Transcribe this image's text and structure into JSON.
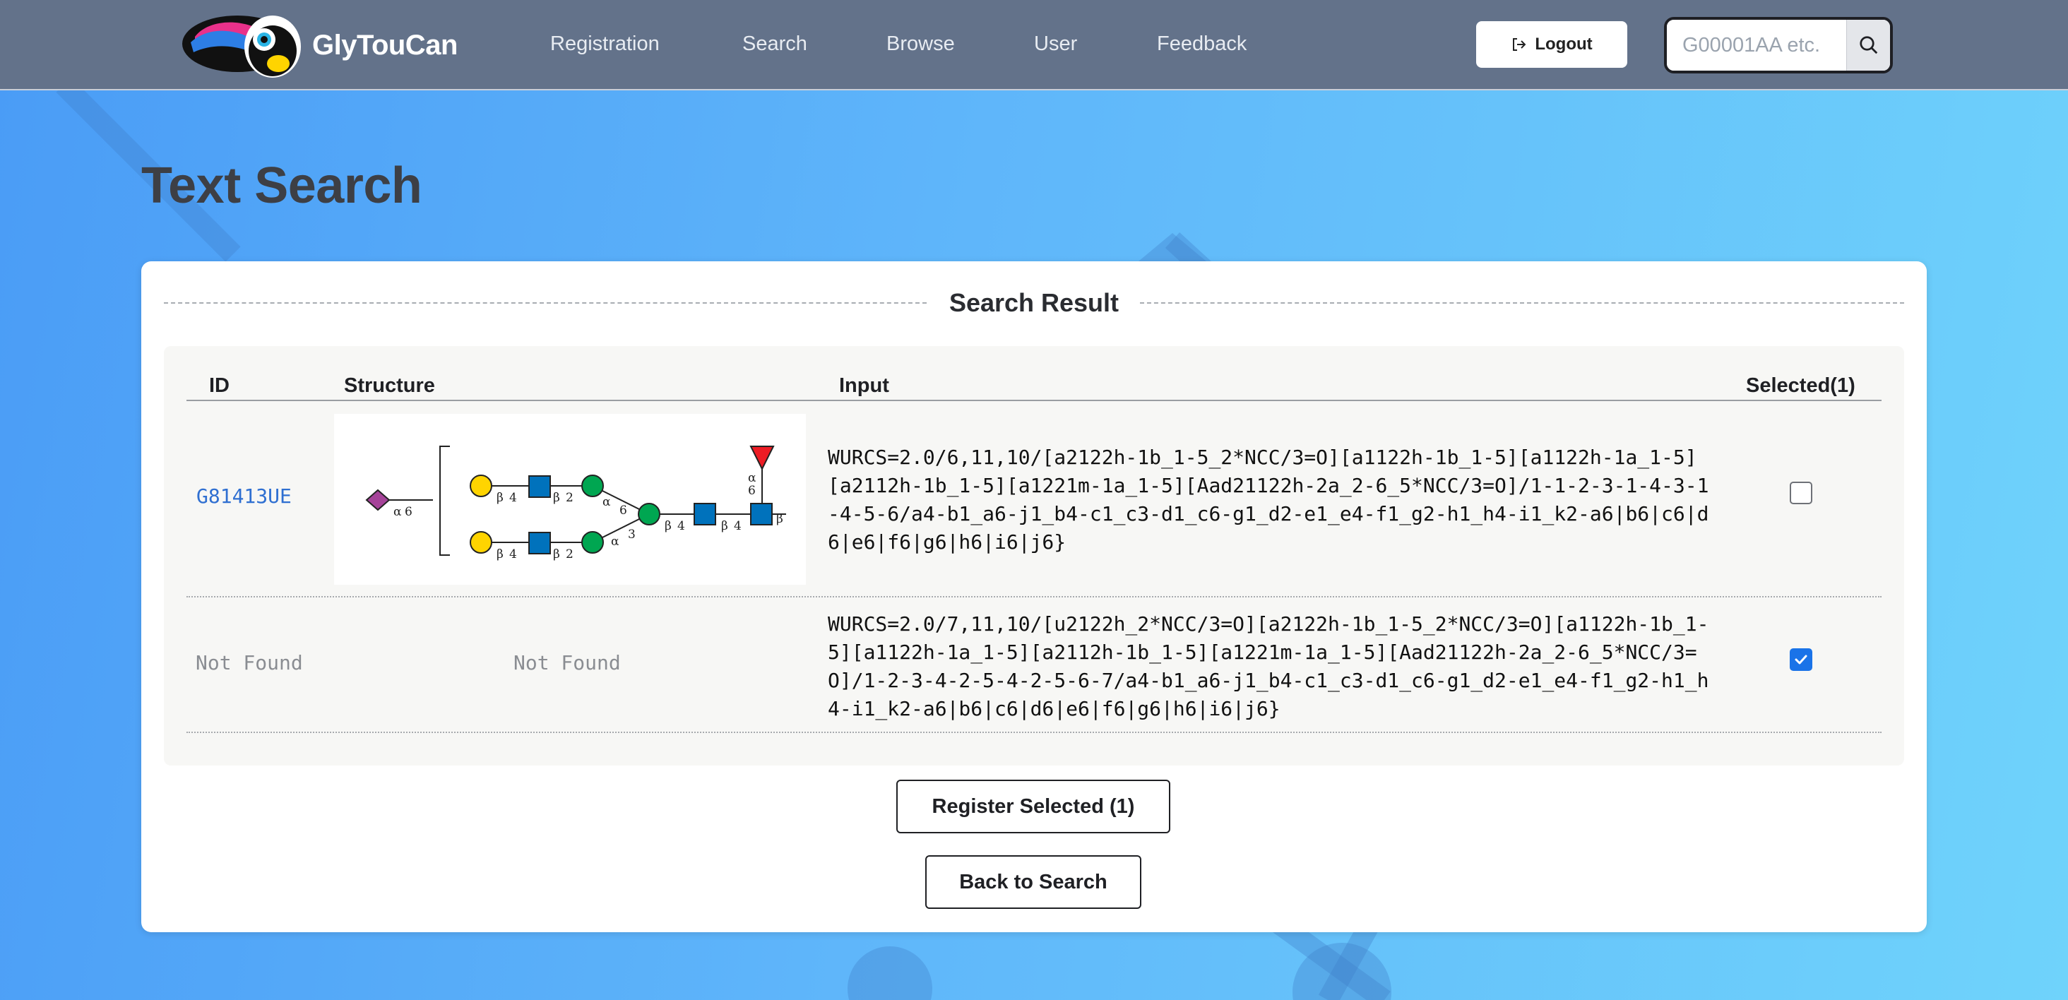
{
  "app": {
    "name": "GlyTouCan"
  },
  "nav": {
    "links": [
      "Registration",
      "Search",
      "Browse",
      "User",
      "Feedback"
    ],
    "logout_label": "Logout",
    "search_placeholder": "G00001AA etc."
  },
  "page": {
    "title": "Text Search"
  },
  "results": {
    "section_title": "Search Result",
    "headers": {
      "id": "ID",
      "structure": "Structure",
      "input": "Input",
      "selected": "Selected(1)"
    },
    "rows": [
      {
        "id": "G81413UE",
        "structure": "glycan-image",
        "input": "WURCS=2.0/6,11,10/[a2122h-1b_1-5_2*NCC/3=O][a1122h-1b_1-5][a1122h-1a_1-5][a2112h-1b_1-5][a1221m-1a_1-5][Aad21122h-2a_2-6_5*NCC/3=O]/1-1-2-3-1-4-3-1-4-5-6/a4-b1_a6-j1_b4-c1_c3-d1_c6-g1_d2-e1_e4-f1_g2-h1_h4-i1_k2-a6|b6|c6|d6|e6|f6|g6|h6|i6|j6}",
        "selected": false
      },
      {
        "id": "Not Found",
        "structure": "Not Found",
        "input": "WURCS=2.0/7,11,10/[u2122h_2*NCC/3=O][a2122h-1b_1-5_2*NCC/3=O][a1122h-1b_1-5][a1122h-1a_1-5][a2112h-1b_1-5][a1221m-1a_1-5][Aad21122h-2a_2-6_5*NCC/3=O]/1-2-3-4-2-5-4-2-5-6-7/a4-b1_a6-j1_b4-c1_c3-d1_c6-g1_d2-e1_e4-f1_g2-h1_h4-i1_k2-a6|b6|c6|d6|e6|f6|g6|h6|i6|j6}",
        "selected": true
      }
    ],
    "structure_labels": {
      "alpha": "α",
      "beta": "β",
      "six": "6",
      "four": "4",
      "two": "2",
      "three": "3"
    }
  },
  "actions": {
    "register_label": "Register Selected (1)",
    "back_label": "Back to Search"
  },
  "colors": {
    "navbar": "#63728a",
    "link": "#2f6fd1",
    "checkbox_checked": "#1a73e8",
    "galactose": "#ffd400",
    "glcnac": "#0072bc",
    "mannose": "#00a651",
    "fucose": "#ed1c24",
    "sialic": "#a54399"
  }
}
